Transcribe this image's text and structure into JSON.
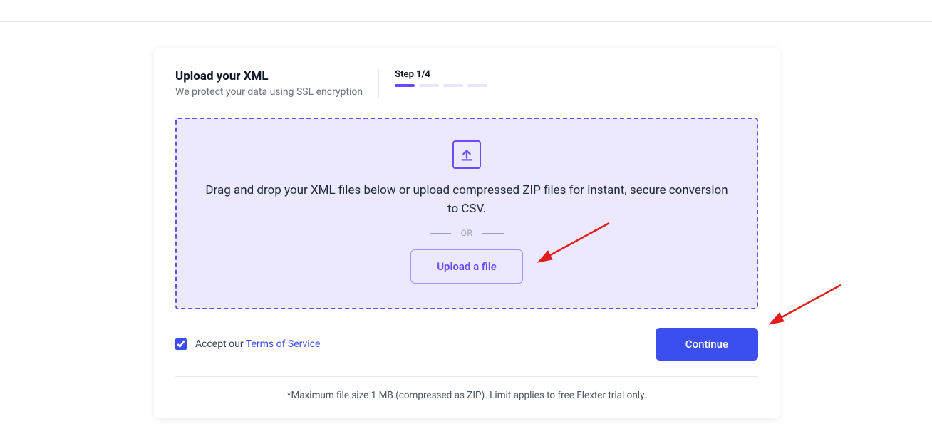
{
  "header": {
    "title": "Upload your XML",
    "subtitle": "We protect your data using SSL encryption",
    "step_label": "Step 1/4",
    "current_step": 1,
    "total_steps": 4
  },
  "dropzone": {
    "instruction": "Drag and drop your XML files below or upload compressed ZIP files for instant, secure conversion to CSV.",
    "separator": "OR",
    "upload_button": "Upload a file"
  },
  "footer": {
    "accept_prefix": "Accept our ",
    "tos_link": "Terms of Service",
    "accept_checked": true,
    "continue_button": "Continue"
  },
  "disclaimer": "*Maximum file size 1 MB (compressed as ZIP). Limit applies to free Flexter trial only.",
  "colors": {
    "accent": "#6d4aff",
    "primary_button": "#3b4ff0",
    "annotation_arrow": "#e11d1d"
  },
  "icons": {
    "upload": "upload-tray-icon"
  }
}
